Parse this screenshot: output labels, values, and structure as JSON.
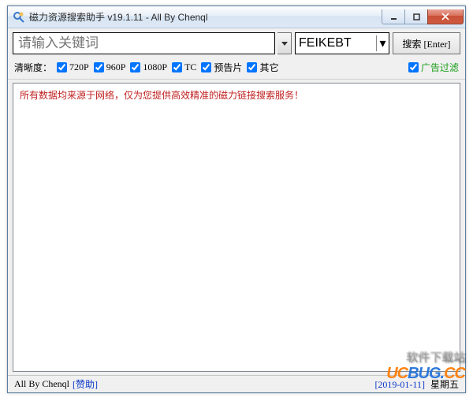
{
  "window": {
    "title": "磁力资源搜索助手 v19.1.11 - All By Chenql"
  },
  "toolbar": {
    "search_placeholder": "请输入关键词",
    "source_selected": "FEIKEBT",
    "search_button": "搜索 [Enter]"
  },
  "filters": {
    "label": "清晰度：",
    "items": [
      {
        "label": "720P",
        "checked": true
      },
      {
        "label": "960P",
        "checked": true
      },
      {
        "label": "1080P",
        "checked": true
      },
      {
        "label": "TC",
        "checked": true
      },
      {
        "label": "预告片",
        "checked": true
      },
      {
        "label": "其它",
        "checked": true
      }
    ],
    "adfilter_label": "广告过滤",
    "adfilter_checked": true
  },
  "content": {
    "message": "所有数据均来源于网络，仅为您提供高效精准的磁力链接搜索服务！"
  },
  "statusbar": {
    "author": "All By Chenql",
    "sponsor": "[赞助]",
    "date": "[2019-01-11]",
    "weekday": "星期五"
  },
  "watermark": {
    "line1": "软件下载站",
    "line2_a": "UC",
    "line2_b": "BUG.",
    "line2_c": "CC"
  }
}
